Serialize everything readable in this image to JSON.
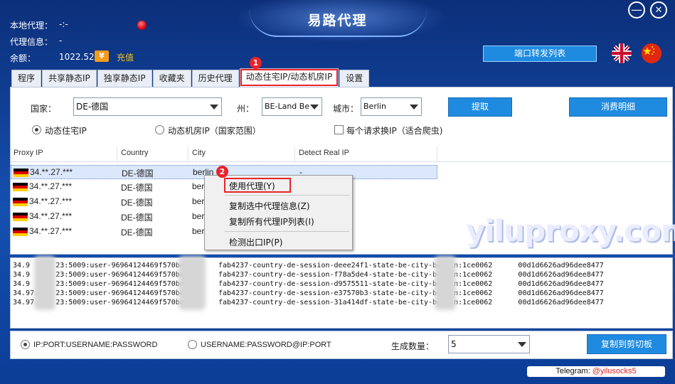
{
  "app": {
    "title": "易路代理"
  },
  "window": {
    "minimize_glyph": "—",
    "close_glyph": "✕"
  },
  "info": {
    "local_proxy_label": "本地代理：",
    "local_proxy_value": "-:-",
    "proxy_info_label": "代理信息：",
    "proxy_info_value": "-",
    "balance_label": "余额：",
    "balance_value": "1022.52",
    "recharge_label": "充值",
    "recharge_icon": "ticket-icon"
  },
  "port_forward_button": "端口转发列表",
  "tabs": [
    {
      "label": "程序"
    },
    {
      "label": "共享静态IP"
    },
    {
      "label": "独享静态IP"
    },
    {
      "label": "收藏夹"
    },
    {
      "label": "历史代理"
    },
    {
      "label": "动态住宅IP/动态机房IP"
    },
    {
      "label": "设置"
    }
  ],
  "filters": {
    "country_label": "国家：",
    "country_value": "DE-德国",
    "state_label": "州：",
    "state_value": "BE-Land Be",
    "city_label": "城市：",
    "city_value": "Berlin",
    "extract_button": "提取",
    "consumption_button": "消费明细",
    "radio_residential": "动态住宅IP",
    "radio_datacenter": "动态机房IP（国家范围）",
    "checkbox_rotate": "每个请求换IP（适合爬虫)"
  },
  "table": {
    "columns": [
      "Proxy IP",
      "Country",
      "City",
      "Detect Real IP"
    ],
    "rows": [
      {
        "ip": "34.**.27.***",
        "country": "DE-德国",
        "city": "berlin",
        "real_ip": "-"
      },
      {
        "ip": "34.**.27.***",
        "country": "DE-德国",
        "city": "berl",
        "real_ip": ""
      },
      {
        "ip": "34.**.27.***",
        "country": "DE-德国",
        "city": "berl",
        "real_ip": ""
      },
      {
        "ip": "34.**.27.***",
        "country": "DE-德国",
        "city": "berl",
        "real_ip": ""
      },
      {
        "ip": "34.**.27.***",
        "country": "DE-德国",
        "city": "berl",
        "real_ip": ""
      }
    ]
  },
  "context_menu": {
    "use_proxy": "使用代理(Y)",
    "copy_selected": "复制选中代理信息(Z)",
    "copy_all": "复制所有代理IP列表(I)",
    "check_exit": "检测出口IP(P)"
  },
  "badges": {
    "one": "1",
    "two": "2"
  },
  "watermark": "yiluproxy.com",
  "output_lines": [
    "34.9      23:5009:user-96964124469f570bac6      fab4237-country-de-session-deee24f1-state-be-city-berlin:1ce0062      00d1d6626ad96dee8477",
    "34.9      23:5009:user-96964124469f570bac6      fab4237-country-de-session-f78a5de4-state-be-city-berlin:1ce0062      00d1d6626ad96dee8477",
    "34.9      23:5009:user-96964124469f570bac6      fab4237-country-de-session-d9575511-state-be-city-berlin:1ce0062      00d1d6626ad96dee8477",
    "34.97.    23:5009:user-96964124469f570bac6      fab4237-country-de-session-e37570b3-state-be-city-berlin:1ce0062      00d1d6626ad96dee8477",
    "34.97.    23:5009:user-96964124469f570bac62     fab4237-country-de-session-31a414df-state-be-city-berlin:1ce0062      00d1d6626ad96dee8477"
  ],
  "format": {
    "option1": "IP:PORT:USERNAME:PASSWORD",
    "option2": "USERNAME:PASSWORD@IP:PORT",
    "count_label": "生成数量：",
    "count_value": "5",
    "copy_button": "复制到剪切板"
  },
  "telegram": {
    "label": "Telegram: ",
    "handle": "@yilusocks5"
  }
}
